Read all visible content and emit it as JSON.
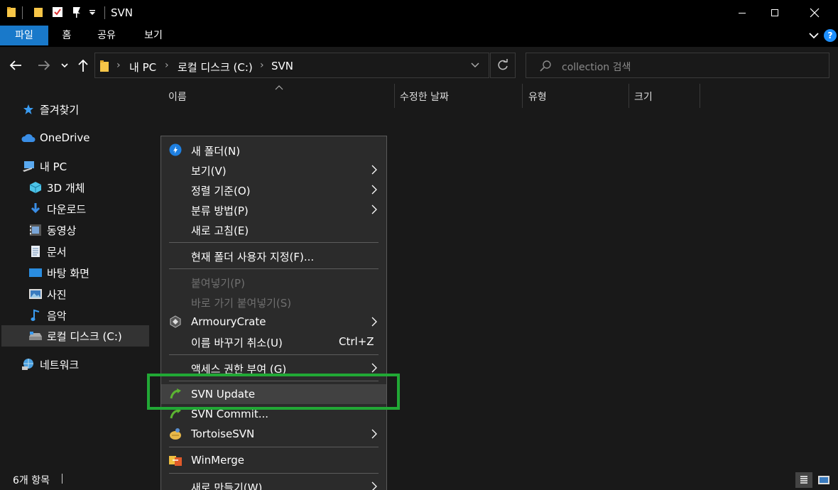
{
  "window": {
    "title": "SVN"
  },
  "ribbon": {
    "tabs": [
      "파일",
      "홈",
      "공유",
      "보기"
    ]
  },
  "address": {
    "crumbs": [
      "내 PC",
      "로컬 디스크 (C:)",
      "SVN"
    ]
  },
  "search": {
    "placeholder": "collection 검색"
  },
  "sidebar": {
    "items": [
      {
        "label": "즐겨찾기",
        "icon": "star-icon"
      },
      {
        "label": "OneDrive",
        "icon": "cloud-icon"
      },
      {
        "label": "내 PC",
        "icon": "computer-icon"
      },
      {
        "label": "3D 개체",
        "icon": "cube-icon"
      },
      {
        "label": "다운로드",
        "icon": "download-icon"
      },
      {
        "label": "동영상",
        "icon": "video-icon"
      },
      {
        "label": "문서",
        "icon": "document-icon"
      },
      {
        "label": "바탕 화면",
        "icon": "desktop-icon"
      },
      {
        "label": "사진",
        "icon": "picture-icon"
      },
      {
        "label": "음악",
        "icon": "music-icon"
      },
      {
        "label": "로컬 디스크 (C:)",
        "icon": "drive-icon"
      },
      {
        "label": "네트워크",
        "icon": "network-icon"
      }
    ]
  },
  "columns": [
    "이름",
    "수정한 날짜",
    "유형",
    "크기"
  ],
  "context_menu": {
    "items": [
      {
        "label": "새 폴더(N)"
      },
      {
        "label": "보기(V)"
      },
      {
        "label": "정렬 기준(O)"
      },
      {
        "label": "분류 방법(P)"
      },
      {
        "label": "새로 고침(E)"
      },
      {
        "label": "현재 폴더 사용자 지정(F)..."
      },
      {
        "label": "붙여넣기(P)"
      },
      {
        "label": "바로 가기 붙여넣기(S)"
      },
      {
        "label": "ArmouryCrate"
      },
      {
        "label": "이름 바꾸기 취소(U)",
        "shortcut": "Ctrl+Z"
      },
      {
        "label": "액세스 권한 부여 (G)"
      },
      {
        "label": "SVN Update"
      },
      {
        "label": "SVN Commit..."
      },
      {
        "label": "TortoiseSVN"
      },
      {
        "label": "WinMerge"
      },
      {
        "label": "새로 만들기(W)"
      }
    ]
  },
  "status": {
    "item_count": "6개 항목"
  },
  "colors": {
    "accent": "#1979ca",
    "highlight": "#21a835"
  }
}
